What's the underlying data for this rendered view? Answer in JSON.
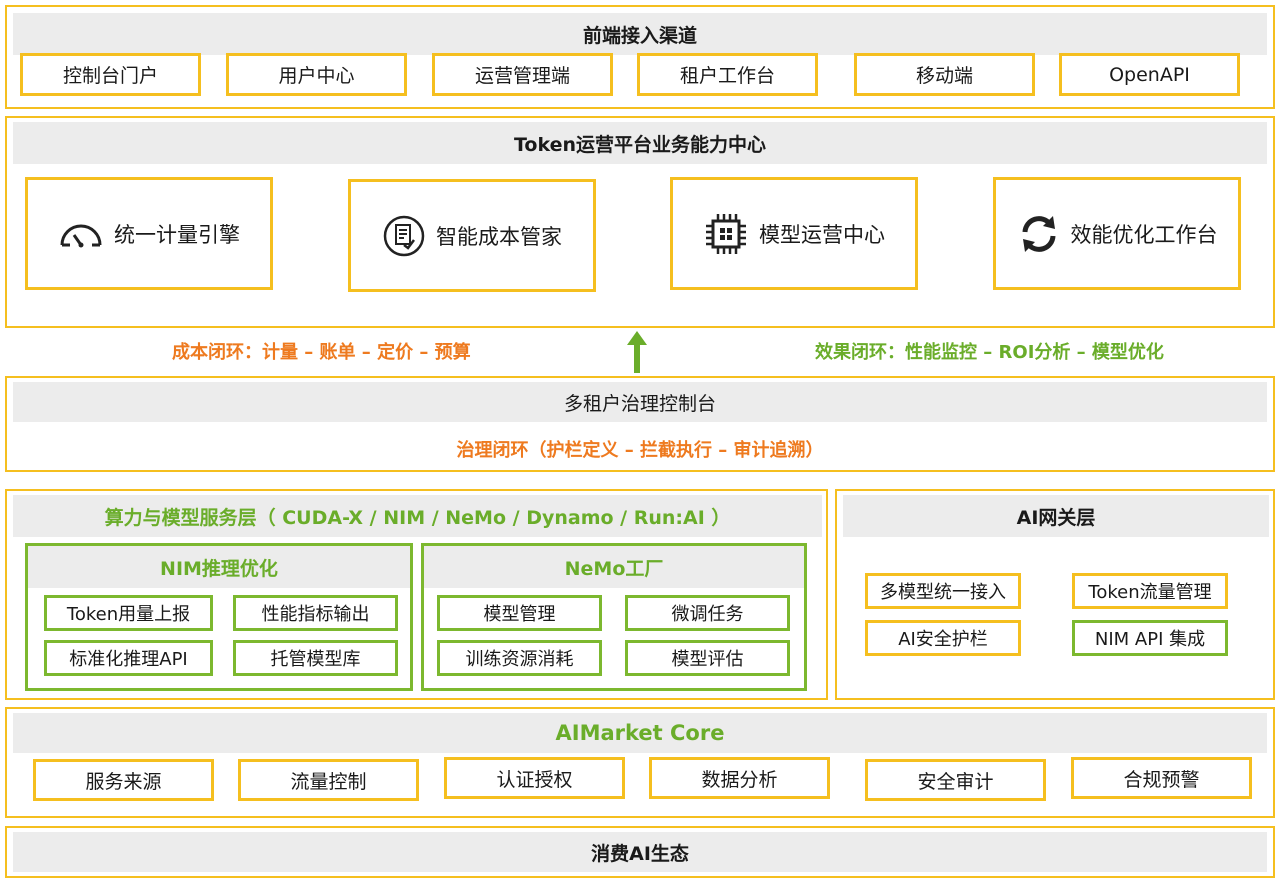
{
  "frontend": {
    "title": "前端接入渠道",
    "channels": [
      "控制台门户",
      "用户中心",
      "运营管理端",
      "租户工作台",
      "移动端",
      "OpenAPI"
    ]
  },
  "token_platform": {
    "title": "Token运营平台业务能力中心",
    "capabilities": [
      {
        "label": "统一计量引擎",
        "icon": "gauge-icon"
      },
      {
        "label": "智能成本管家",
        "icon": "document-check-icon"
      },
      {
        "label": "模型运营中心",
        "icon": "chip-icon"
      },
      {
        "label": "效能优化工作台",
        "icon": "refresh-cycle-icon"
      }
    ]
  },
  "loops": {
    "cost": "成本闭环：计量 – 账单 – 定价 – 预算",
    "effect": "效果闭环：性能监控 – ROI分析 – 模型优化",
    "arrow_icon": "up-arrow-icon"
  },
  "governance": {
    "title": "多租户治理控制台",
    "loop": "治理闭环（护栏定义 – 拦截执行 – 审计追溯）"
  },
  "compute": {
    "title": "算力与模型服务层（ CUDA-X / NIM / NeMo / Dynamo / Run:AI ）",
    "nim": {
      "title": "NIM推理优化",
      "items": [
        "Token用量上报",
        "性能指标输出",
        "标准化推理API",
        "托管模型库"
      ]
    },
    "nemo": {
      "title": "NeMo工厂",
      "items": [
        "模型管理",
        "微调任务",
        "训练资源消耗",
        "模型评估"
      ]
    }
  },
  "gateway": {
    "title": "AI网关层",
    "items": [
      "多模型统一接入",
      "Token流量管理",
      "AI安全护栏",
      "NIM API 集成"
    ]
  },
  "aimarket": {
    "title": "AIMarket Core",
    "items": [
      "服务来源",
      "流量控制",
      "认证授权",
      "数据分析",
      "安全审计",
      "合规预警"
    ]
  },
  "ecosystem": {
    "title": "消费AI生态"
  },
  "colors": {
    "yellow": "#f5bf1f",
    "green": "#7cb82f",
    "orange": "#ee7a1f",
    "band_gray": "#ececec"
  }
}
